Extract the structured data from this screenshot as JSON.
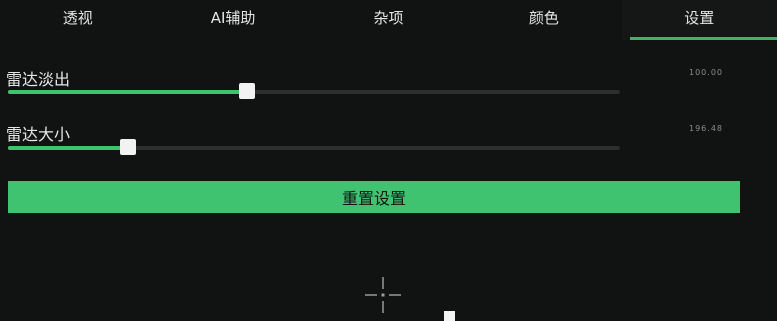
{
  "tabs": [
    {
      "label": "透视",
      "active": false
    },
    {
      "label": "AI辅助",
      "active": false
    },
    {
      "label": "杂项",
      "active": false
    },
    {
      "label": "颜色",
      "active": false
    },
    {
      "label": "设置",
      "active": true
    }
  ],
  "sliders": {
    "fade": {
      "label": "雷达淡出",
      "value_text": "100.00",
      "fraction": 0.39
    },
    "size": {
      "label": "雷达大小",
      "value_text": "196.48",
      "fraction": 0.196
    }
  },
  "reset_button": {
    "label": "重置设置"
  },
  "colors": {
    "accent": "#3ec46d",
    "background": "#111312",
    "track": "#2c2e2d"
  },
  "icons": {
    "crosshair": "crosshair-icon"
  }
}
